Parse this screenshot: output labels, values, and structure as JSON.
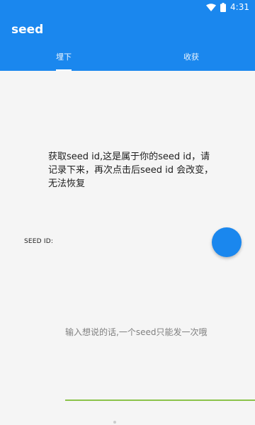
{
  "status_bar": {
    "time": "4:31",
    "icons": [
      "wifi-icon",
      "battery-icon"
    ]
  },
  "app_bar": {
    "title": "seed",
    "color": "#1a87ee"
  },
  "tabs": [
    {
      "label": "埋下",
      "selected": true
    },
    {
      "label": "收获",
      "selected": false
    }
  ],
  "main": {
    "info_text": "获取seed id,这是属于你的seed id，请记录下来，再次点击后seed id 会改变，无法恢复",
    "seed_id_label": "SEED ID:",
    "message_placeholder": "输入想说的话,一个seed只能发一次哦",
    "underline_color": "#8bc34a"
  }
}
